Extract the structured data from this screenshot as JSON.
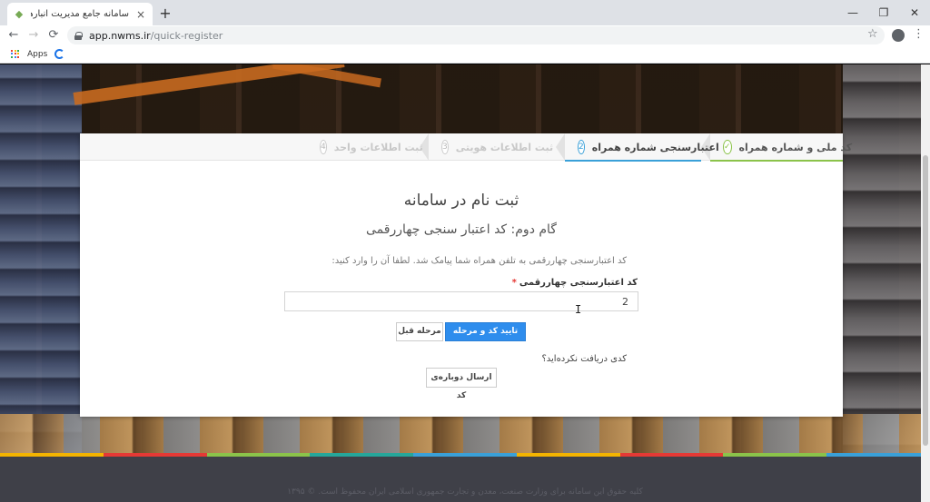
{
  "browser": {
    "tab_title": "سامانه جامع مدیریت انبارها و مراکز",
    "tab_close": "×",
    "new_tab": "+",
    "url_host": "app.nwms.ir",
    "url_path": "/quick-register",
    "bookmarks_apps_label": "Apps",
    "window_minimize": "—",
    "window_restore": "❐",
    "window_close": "✕",
    "back": "←",
    "forward": "→",
    "reload": "⟳",
    "star": "☆",
    "menu": "⋮"
  },
  "wizard": {
    "steps": [
      {
        "number": "✓",
        "label": "کد ملی و شماره همراه",
        "state": "done"
      },
      {
        "number": "2",
        "label": "اعتبارسنجی شماره همراه",
        "state": "active"
      },
      {
        "number": "3",
        "label": "ثبت اطلاعات هویتی",
        "state": "pending"
      },
      {
        "number": "4",
        "label": "ثبت اطلاعات واحد",
        "state": "pending"
      }
    ],
    "title": "ثبت نام در سامانه",
    "subtitle": "گام دوم: کد اعتبار سنجی چهاررقمی",
    "instruction": "کد اعتبارسنجی چهاررقمی به تلفن همراه شما پیامک شد. لطفا آن را وارد کنید:",
    "field_label": "کد اعتبارسنجی چهاررقمی",
    "required_mark": "*",
    "code_value": "2",
    "next_button": "تایید کد و مرحله بعد",
    "prev_button": "مرحله قبل",
    "not_received": "کدی دریافت نکرده‌اید؟",
    "resend_button": "ارسال دوباره‌ی کد"
  },
  "footer": {
    "copyright": "کلیه حقوق این سامانه برای وزارت صنعت، معدن و تجارت جمهوری اسلامی ایران محفوظ است. © ۱۳۹۵"
  },
  "colors": {
    "primary": "#2e8ded",
    "step_done": "#8bc34a",
    "step_active": "#3aa0d8",
    "footer_bg": "#3f4048",
    "footer_stripe": [
      "#f4b400",
      "#e53935",
      "#8bc34a",
      "#26a69a",
      "#3aa0d8",
      "#f4b400",
      "#e53935",
      "#8bc34a",
      "#3aa0d8"
    ]
  }
}
